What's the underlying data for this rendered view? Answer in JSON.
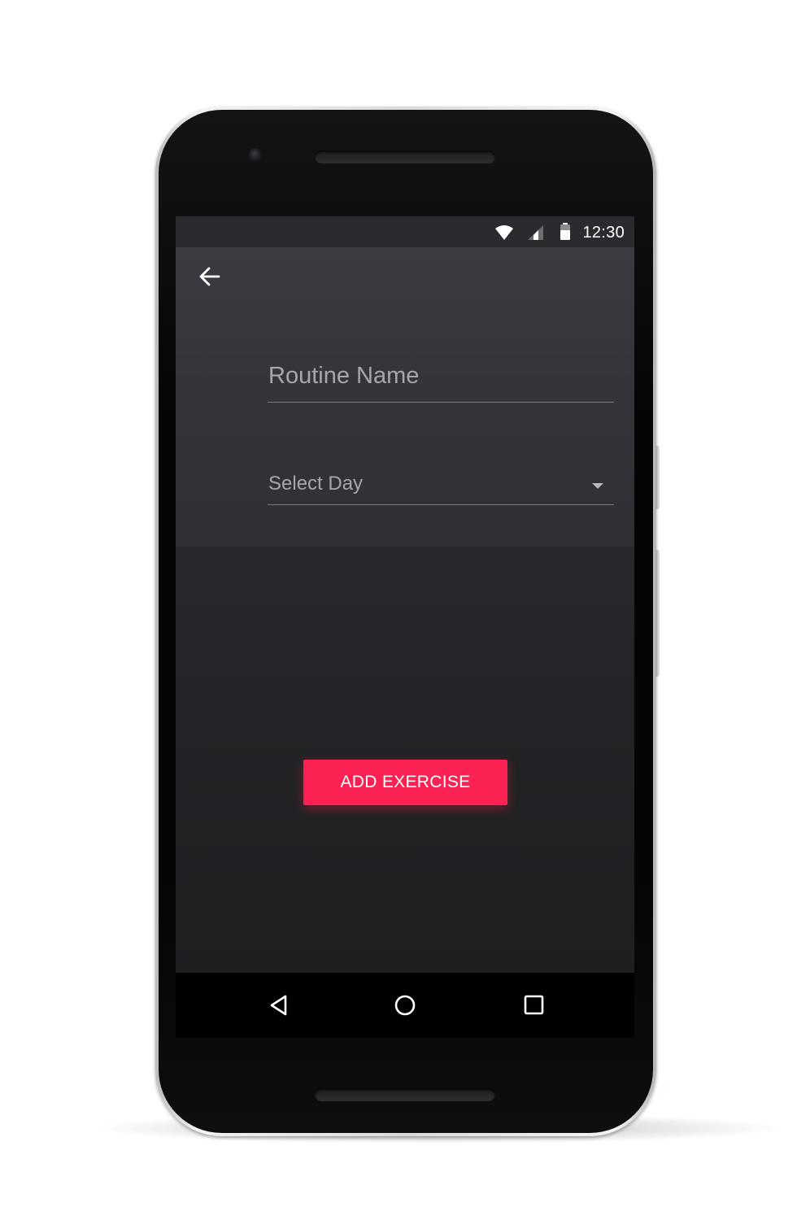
{
  "status_bar": {
    "time": "12:30",
    "wifi_icon": "wifi-icon",
    "signal_icon": "cell-signal-icon",
    "battery_icon": "battery-icon"
  },
  "header": {
    "back_icon": "arrow-left-icon",
    "routine_name": {
      "placeholder": "Routine Name",
      "value": ""
    },
    "day_select": {
      "selected": "Select Day",
      "caret_icon": "chevron-down-icon"
    }
  },
  "main": {
    "add_exercise_label": "ADD EXERCISE"
  },
  "nav_bar": {
    "back_icon": "nav-back-triangle-icon",
    "home_icon": "nav-home-circle-icon",
    "recents_icon": "nav-recents-square-icon"
  },
  "colors": {
    "accent": "#fb2152",
    "header_bg": "#36373c",
    "content_bg": "#232427",
    "status_bar_bg": "#2a2b2f",
    "field_text": "#a6a7aa"
  }
}
